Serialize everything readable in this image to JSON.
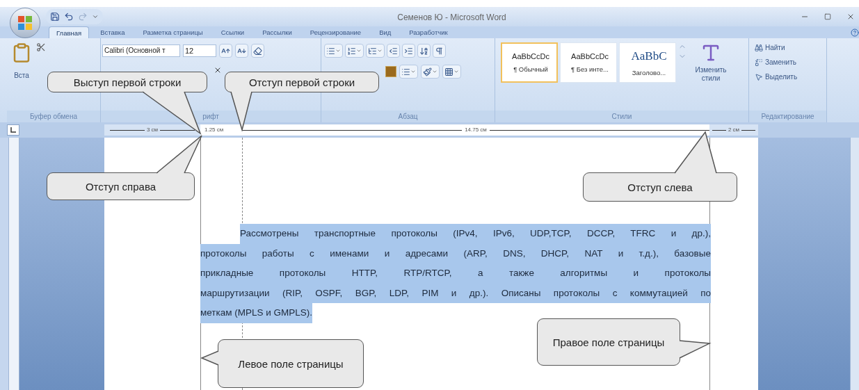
{
  "window": {
    "title": "Семенов Ю - Microsoft Word"
  },
  "tabs": [
    {
      "label": "Главная",
      "selected": true
    },
    {
      "label": "Вставка",
      "selected": false
    },
    {
      "label": "Разметка страницы",
      "selected": false
    },
    {
      "label": "Ссылки",
      "selected": false
    },
    {
      "label": "Рассылки",
      "selected": false
    },
    {
      "label": "Рецензирование",
      "selected": false
    },
    {
      "label": "Вид",
      "selected": false
    },
    {
      "label": "Разработчик",
      "selected": false
    }
  ],
  "ribbon": {
    "paste_label": "Вста",
    "font_name": "Calibri (Основной т",
    "font_size": "12",
    "groups": [
      "Буфер обмена",
      "рифт",
      "Абзац",
      "Стили",
      "Редактирование"
    ],
    "styles": [
      {
        "sample": "AaBbCcDc",
        "name": "¶ Обычный",
        "selected": true
      },
      {
        "sample": "AaBbCcDc",
        "name": "¶ Без инте...",
        "selected": false
      },
      {
        "sample": "AaBbC",
        "name": "Заголово...",
        "selected": false
      }
    ],
    "change_styles": "Изменить стили",
    "editing": [
      {
        "label": "Найти",
        "kind": "find"
      },
      {
        "label": "Заменить",
        "kind": "replace"
      },
      {
        "label": "Выделить",
        "kind": "select"
      }
    ]
  },
  "ruler": {
    "left_margin": "3 см",
    "first_line_indent": "1.25 см",
    "text_width": "14.75 см",
    "right_margin": "2 см"
  },
  "document": {
    "paragraph_lines": [
      "Рассмотрены транспортные протоколы (IPv4, IPv6, UDP,TCP, DCCP, TFRC и др.),",
      "протоколы работы с именами и адресами (ARP, DNS, DHCP, NAT и т.д.), базовые",
      "прикладные протоколы HTTP, RTP/RTCP, а также алгоритмы и протоколы",
      "маршрутизации (RIP, OSPF, BGP, LDP, PIM и др.). Описаны протоколы с коммутацией по",
      "меткам (MPLS и GMPLS)."
    ]
  },
  "callouts": [
    "Выступ первой строки",
    "Отступ первой строки",
    "Отступ справа",
    "Отступ слева",
    "Левое поле страницы",
    "Правое поле страницы"
  ]
}
